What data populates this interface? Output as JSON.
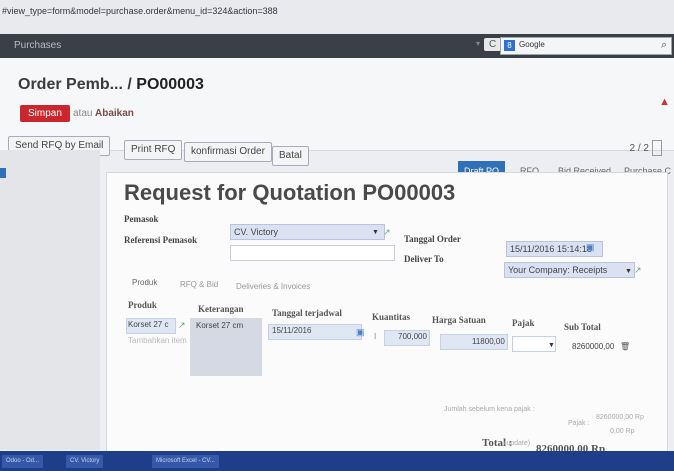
{
  "browser": {
    "url": "#view_type=form&model=purchase.order&menu_id=324&action=388",
    "search_engine": "Google"
  },
  "topnav": {
    "menu": "Purchases"
  },
  "header": {
    "breadcrumb_parent": "Order Pemb...",
    "breadcrumb_sep": " / ",
    "breadcrumb_current": "PO00003",
    "save_label": "Simpan",
    "or_label": "atau",
    "discard_label": "Abaikan",
    "buttons": [
      "Send RFQ by Email",
      "Print RFQ",
      "konfirmasi Order",
      "Batal"
    ],
    "pager": "2 / 2"
  },
  "statusbar": {
    "steps": [
      "Draft PO",
      "RFQ",
      "Bid Received",
      "Purchase C"
    ],
    "active_index": 0
  },
  "form": {
    "title": "Request for Quotation PO00003",
    "supplier_label": "Pemasok",
    "supplier_value": "CV. Victory",
    "reference_label": "Referensi Pemasok",
    "order_date_label": "Tanggal Order",
    "order_date_value": "15/11/2016 15:14:18",
    "deliver_to_label": "Deliver To",
    "deliver_to_value": "Your Company: Receipts",
    "tabs": [
      "Produk",
      "RFQ & Bid",
      "Deliveries & Invoices"
    ]
  },
  "table": {
    "headers": [
      "Produk",
      "Keterangan",
      "Tanggal terjadwal",
      "Kuantitas",
      "Harga Satuan",
      "Pajak",
      "Sub Total"
    ],
    "row": {
      "product": "Korset 27 c",
      "description": "Korset 27 cm",
      "date": "15/11/2016",
      "quantity": "700,000",
      "unit_price": "11800,00",
      "tax": "",
      "subtotal": "8260000,00"
    },
    "add_item": "Tambahkan item"
  },
  "totals": {
    "untaxed_label": "Jumlah sebelum kena pajak :",
    "untaxed_value": "8260000,00 Rp",
    "tax_label": "Pajak :",
    "tax_value": "0,00 Rp",
    "total_label": "Total :",
    "total_hint": "(update)",
    "total_value": "8260000,00 Rp"
  },
  "taskbar": {
    "items": [
      "Odoo - Od...",
      "CV. Victory",
      "Microsoft Excel - CV..."
    ]
  },
  "colors": {
    "accent": "#2f70b9",
    "save": "#c9272d",
    "topnav": "#3b3f46"
  }
}
